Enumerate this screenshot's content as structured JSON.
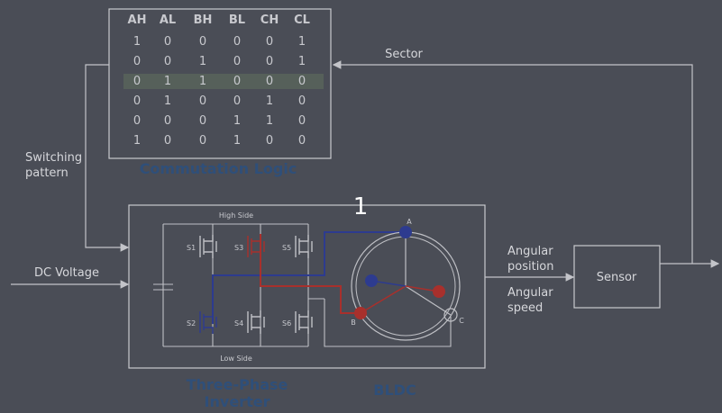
{
  "commutation_table": {
    "headers": [
      "AH",
      "AL",
      "BH",
      "BL",
      "CH",
      "CL"
    ],
    "rows": [
      [
        "1",
        "0",
        "0",
        "0",
        "0",
        "1"
      ],
      [
        "0",
        "0",
        "1",
        "0",
        "0",
        "1"
      ],
      [
        "0",
        "1",
        "1",
        "0",
        "0",
        "0"
      ],
      [
        "0",
        "1",
        "0",
        "0",
        "1",
        "0"
      ],
      [
        "0",
        "0",
        "0",
        "1",
        "1",
        "0"
      ],
      [
        "1",
        "0",
        "0",
        "1",
        "0",
        "0"
      ]
    ],
    "highlighted_row": 2,
    "title": "Commutation Logic"
  },
  "labels": {
    "sector": "Sector",
    "switching_pattern": [
      "Switching",
      "pattern"
    ],
    "dc_voltage": "DC Voltage",
    "angular_position": [
      "Angular",
      "position"
    ],
    "angular_speed": [
      "Angular",
      "speed"
    ],
    "sensor": "Sensor",
    "inverter_title": [
      "Three-Phase",
      "Inverter"
    ],
    "bldc_title": "BLDC",
    "high_side": "High Side",
    "low_side": "Low Side",
    "switches": [
      "S1",
      "S3",
      "S5",
      "S2",
      "S4",
      "S6"
    ],
    "phases": [
      "A",
      "B",
      "C"
    ],
    "overlay_number": "1"
  },
  "colors": {
    "background": "#4a4d56",
    "title_blue": "#2f4f79",
    "phase_blue": "#2d3b8f",
    "phase_red": "#a8302c",
    "highlight_row": "#56605a"
  }
}
